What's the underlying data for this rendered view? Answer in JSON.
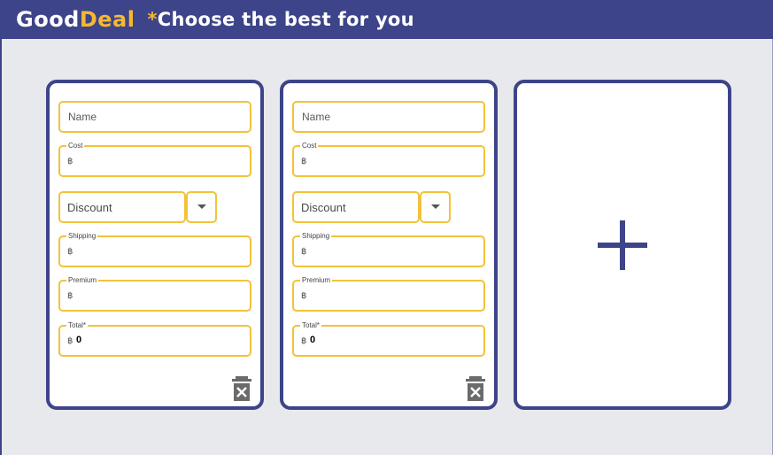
{
  "header": {
    "brand_part1": "Good",
    "brand_part2": "Deal",
    "star": "*",
    "tagline": "Choose the best for you"
  },
  "colors": {
    "primary": "#3d4489",
    "accent": "#f5b830",
    "field_border": "#f2c23a",
    "background": "#e8e9ec"
  },
  "cards": [
    {
      "name_placeholder": "Name",
      "cost_label": "Cost",
      "cost_currency": "฿",
      "discount_placeholder": "Discount",
      "shipping_label": "Shipping",
      "shipping_currency": "฿",
      "premium_label": "Premium",
      "premium_currency": "฿",
      "total_label": "Total*",
      "total_currency": "฿",
      "total_value": "0",
      "delete_icon": "trash-icon"
    },
    {
      "name_placeholder": "Name",
      "cost_label": "Cost",
      "cost_currency": "฿",
      "discount_placeholder": "Discount",
      "shipping_label": "Shipping",
      "shipping_currency": "฿",
      "premium_label": "Premium",
      "premium_currency": "฿",
      "total_label": "Total*",
      "total_currency": "฿",
      "total_value": "0",
      "delete_icon": "trash-icon"
    }
  ],
  "add_card": {
    "icon": "plus-icon"
  }
}
